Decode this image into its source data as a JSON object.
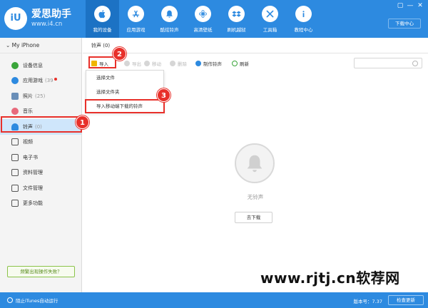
{
  "app": {
    "logo_badge": "iU",
    "title": "爱思助手",
    "url": "www.i4.cn",
    "window_controls": [
      "▢",
      "—",
      "✕"
    ],
    "download_center": "下载中心"
  },
  "nav": [
    {
      "label": "我的设备",
      "icon": "apple-icon",
      "active": true
    },
    {
      "label": "应用游戏",
      "icon": "app-store-icon",
      "active": false
    },
    {
      "label": "酷炫铃声",
      "icon": "bell-icon",
      "active": false
    },
    {
      "label": "高清壁纸",
      "icon": "flower-icon",
      "active": false
    },
    {
      "label": "刷机越狱",
      "icon": "dropbox-icon",
      "active": false
    },
    {
      "label": "工具箱",
      "icon": "tools-icon",
      "active": false
    },
    {
      "label": "教程中心",
      "icon": "info-icon",
      "active": false
    }
  ],
  "sidebar": {
    "device": "My iPhone",
    "items": [
      {
        "label": "设备信息",
        "count": "",
        "color": "#3aa53a"
      },
      {
        "label": "应用游戏",
        "count": "(39",
        "color": "#2d8ae0"
      },
      {
        "label": "照片",
        "count": "(25)",
        "color": "#6a8fb8"
      },
      {
        "label": "音乐",
        "count": "",
        "color": "#e86a7c"
      },
      {
        "label": "铃声",
        "count": "(0)",
        "color": "#2d8ae0"
      },
      {
        "label": "视频",
        "count": "",
        "color": "#555"
      },
      {
        "label": "电子书",
        "count": "",
        "color": "#555"
      },
      {
        "label": "资料管理",
        "count": "",
        "color": "#555"
      },
      {
        "label": "文件管理",
        "count": "",
        "color": "#555"
      },
      {
        "label": "更多功能",
        "count": "",
        "color": "#555"
      }
    ],
    "help": "频繁出现操作失败？"
  },
  "main": {
    "title": "铃声 (0)",
    "toolbar": {
      "import": "导入",
      "export": "导出",
      "move": "移动",
      "delete": "删除",
      "make": "制作铃声",
      "refresh": "刷新"
    },
    "dropdown": [
      "选择文件",
      "选择文件夹",
      "导入移动端下载的铃声"
    ],
    "empty_text": "无铃声",
    "goto_download": "去下载"
  },
  "callouts": [
    "1",
    "2",
    "3"
  ],
  "status": {
    "itunes": "阻止iTunes自动运行",
    "version": "版本号：7.37",
    "check_update": "检查更新"
  },
  "watermark": "www.rjtj.cn软荐网"
}
